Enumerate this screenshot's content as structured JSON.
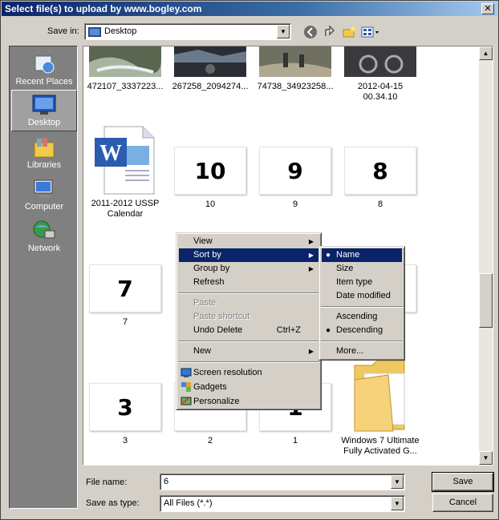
{
  "window": {
    "title": "Select file(s) to upload by www.bogley.com",
    "close_glyph": "✕"
  },
  "toolbar": {
    "save_in_label": "Save in:",
    "save_in_value": "Desktop",
    "back_icon": "back-icon",
    "up_icon": "up-folder-icon",
    "new_folder_icon": "new-folder-icon",
    "view_icon": "view-menu-icon"
  },
  "places": [
    {
      "label": "Recent Places",
      "icon": "recent-places-icon"
    },
    {
      "label": "Desktop",
      "icon": "desktop-icon"
    },
    {
      "label": "Libraries",
      "icon": "libraries-icon"
    },
    {
      "label": "Computer",
      "icon": "computer-icon"
    },
    {
      "label": "Network",
      "icon": "network-icon"
    }
  ],
  "files": {
    "row1": [
      "472107_3337223...",
      "267258_2094274...",
      "74738_34923258...",
      "2012-04-15\n00.34.10"
    ],
    "word_doc": "2011-2012 USSP\nCalendar",
    "thumbs_row2": [
      {
        "label": "10",
        "caption": "10"
      },
      {
        "label": "9",
        "caption": "9"
      },
      {
        "label": "8",
        "caption": "8"
      }
    ],
    "thumb_7": {
      "label": "7",
      "caption": "7"
    },
    "thumbs_row4": [
      {
        "label": "3",
        "caption": "3"
      },
      {
        "label": "",
        "caption": "2"
      },
      {
        "label": "1",
        "caption": "1"
      }
    ],
    "folder": "Windows 7 Ultimate\nFully Activated G..."
  },
  "context_menu": {
    "view": "View",
    "sort_by": "Sort by",
    "group_by": "Group by",
    "refresh": "Refresh",
    "paste": "Paste",
    "paste_shortcut": "Paste shortcut",
    "undo_delete": "Undo Delete",
    "undo_shortcut": "Ctrl+Z",
    "new": "New",
    "screen_resolution": "Screen resolution",
    "gadgets": "Gadgets",
    "personalize": "Personalize"
  },
  "sort_menu": {
    "name": "Name",
    "size": "Size",
    "item_type": "Item type",
    "date_modified": "Date modified",
    "ascending": "Ascending",
    "descending": "Descending",
    "more": "More..."
  },
  "bottom": {
    "file_name_label": "File name:",
    "file_name_value": "6",
    "save_as_type_label": "Save as type:",
    "save_as_type_value": "All Files (*.*)",
    "save_button": "Save",
    "cancel_button": "Cancel"
  },
  "colors": {
    "title_start": "#0a246a",
    "highlight": "#0a246a",
    "face": "#d4d0c8"
  }
}
